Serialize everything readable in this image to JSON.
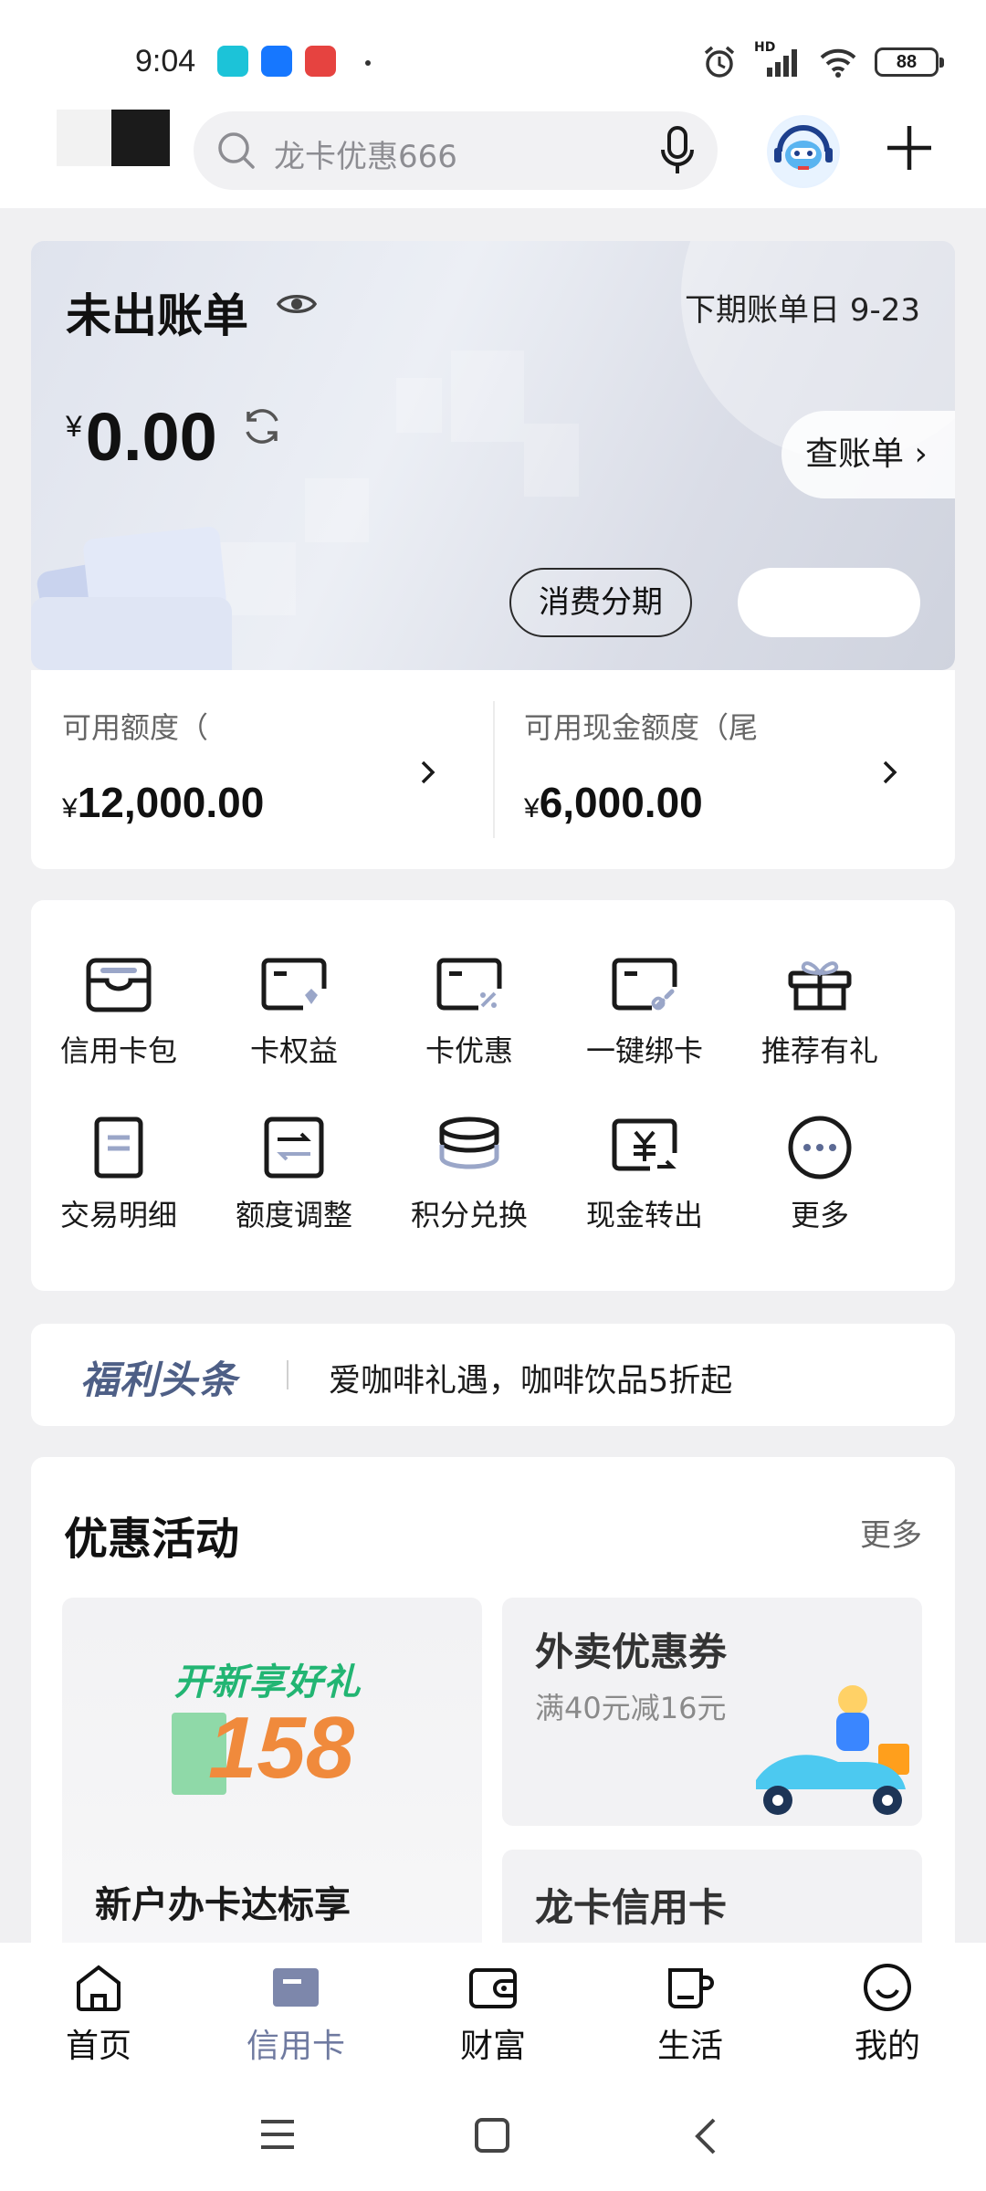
{
  "status_bar": {
    "time": "9:04",
    "battery": "88",
    "network": "HD"
  },
  "header": {
    "search_placeholder": "龙卡优惠666"
  },
  "bill_card": {
    "title": "未出账单",
    "due_date": "下期账单日  9-23",
    "currency": "¥",
    "amount": "0.00",
    "view_bill": "查账单 ›",
    "installment": "消费分期"
  },
  "credit": {
    "available_label": "可用额度（",
    "available_value": "12,000.00",
    "cash_label": "可用现金额度（尾",
    "cash_value": "6,000.00",
    "currency": "¥"
  },
  "grid": {
    "items": [
      {
        "label": "信用卡包",
        "icon": "card-wallet-icon"
      },
      {
        "label": "卡权益",
        "icon": "card-benefit-icon"
      },
      {
        "label": "卡优惠",
        "icon": "card-discount-icon"
      },
      {
        "label": "一键绑卡",
        "icon": "card-bind-icon"
      },
      {
        "label": "推荐有礼",
        "icon": "gift-icon"
      },
      {
        "label": "交易明细",
        "icon": "transaction-detail-icon"
      },
      {
        "label": "额度调整",
        "icon": "limit-adjust-icon"
      },
      {
        "label": "积分兑换",
        "icon": "points-exchange-icon"
      },
      {
        "label": "现金转出",
        "icon": "cash-transfer-icon"
      },
      {
        "label": "更多",
        "icon": "more-icon"
      }
    ]
  },
  "news": {
    "brand": "福利头条",
    "text": "爱咖啡礼遇，咖啡饮品5折起"
  },
  "promo": {
    "title": "优惠活动",
    "more": "更多",
    "left_banner_text": "开新享好礼",
    "left_banner_number": "158",
    "left_caption": "新户办卡达标享",
    "right_top_title": "外卖优惠券",
    "right_top_sub": "满40元减16元",
    "right_bottom_title": "龙卡信用卡"
  },
  "tabs": [
    {
      "label": "首页",
      "icon": "home-icon",
      "active": false
    },
    {
      "label": "信用卡",
      "icon": "credit-card-icon",
      "active": true
    },
    {
      "label": "财富",
      "icon": "wallet-icon",
      "active": false
    },
    {
      "label": "生活",
      "icon": "cup-icon",
      "active": false
    },
    {
      "label": "我的",
      "icon": "smile-icon",
      "active": false
    }
  ],
  "colors": {
    "accent": "#6f7aa0",
    "news_brand": "#4e5f86",
    "background": "#f0f0f2"
  }
}
